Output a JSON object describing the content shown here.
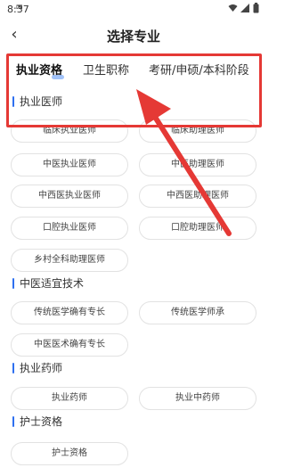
{
  "status_bar": {
    "time": "8:37"
  },
  "header": {
    "title": "选择专业"
  },
  "tabs": [
    {
      "label": "执业资格",
      "active": true
    },
    {
      "label": "卫生职称",
      "active": false
    },
    {
      "label": "考研/申硕/本科阶段",
      "active": false
    }
  ],
  "sections": [
    {
      "title": "执业医师",
      "items": [
        "临床执业医师",
        "临床助理医师",
        "中医执业医师",
        "中医助理医师",
        "中西医执业医师",
        "中西医助理医师",
        "口腔执业医师",
        "口腔助理医师",
        "乡村全科助理医师"
      ]
    },
    {
      "title": "中医适宜技术",
      "items": [
        "传统医学确有专长",
        "传统医学师承",
        "中医医术确有专长"
      ]
    },
    {
      "title": "执业药师",
      "items": [
        "执业药师",
        "执业中药师"
      ]
    },
    {
      "title": "护士资格",
      "items": [
        "护士资格"
      ]
    }
  ],
  "colors": {
    "accent": "#2e6ff0",
    "annotation": "#e53935"
  },
  "icons": {
    "back": "chevron-left-icon",
    "wifi": "wifi-icon",
    "signal": "signal-icon",
    "battery": "battery-icon"
  }
}
